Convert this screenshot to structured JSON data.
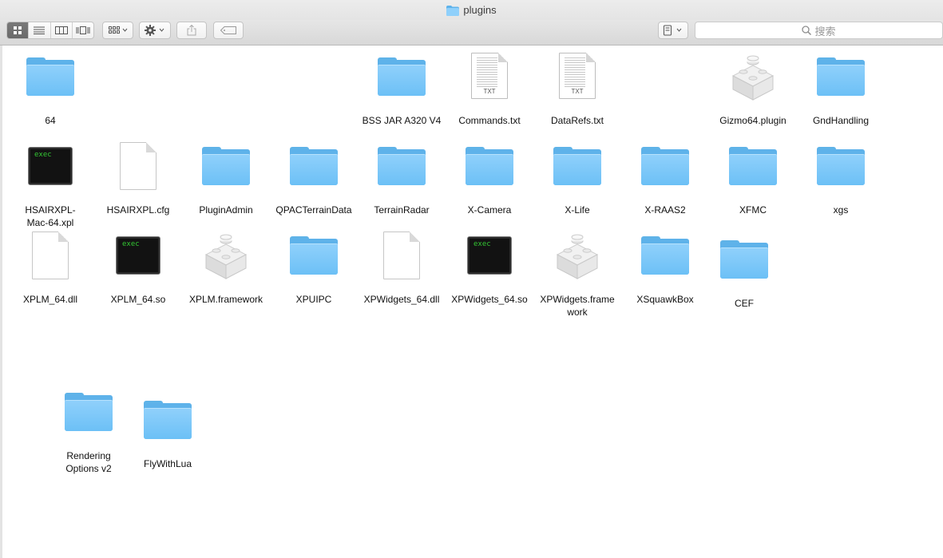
{
  "window": {
    "title": "plugins"
  },
  "toolbar": {
    "view_icons": [
      "icon-view-icon",
      "list-view-icon",
      "column-view-icon",
      "coverflow-view-icon"
    ],
    "arrange_icon": "arrange-icon",
    "action_icon": "gear-icon",
    "share_icon": "share-icon",
    "tag_icon": "tag-icon",
    "path_icon": "path-icon",
    "search_placeholder": "搜索"
  },
  "items": [
    {
      "label": "64",
      "type": "folder"
    },
    {
      "label": "BSS JAR A320 V4",
      "type": "folder"
    },
    {
      "label": "Commands.txt",
      "type": "txt"
    },
    {
      "label": "DataRefs.txt",
      "type": "txt"
    },
    {
      "label": "Gizmo64.plugin",
      "type": "plugin"
    },
    {
      "label": "GndHandling",
      "type": "folder"
    },
    {
      "label": "HSAIRXPL-\nMac-64.xpl",
      "type": "exec"
    },
    {
      "label": "HSAIRXPL.cfg",
      "type": "blank"
    },
    {
      "label": "PluginAdmin",
      "type": "folder"
    },
    {
      "label": "QPACTerrainData",
      "type": "folder"
    },
    {
      "label": "TerrainRadar",
      "type": "folder"
    },
    {
      "label": "X-Camera",
      "type": "folder"
    },
    {
      "label": "X-Life",
      "type": "folder"
    },
    {
      "label": "X-RAAS2",
      "type": "folder"
    },
    {
      "label": "XFMC",
      "type": "folder"
    },
    {
      "label": "xgs",
      "type": "folder"
    },
    {
      "label": "XPLM_64.dll",
      "type": "blank"
    },
    {
      "label": "XPLM_64.so",
      "type": "exec"
    },
    {
      "label": "XPLM.framework",
      "type": "plugin"
    },
    {
      "label": "XPUIPC",
      "type": "folder"
    },
    {
      "label": "XPWidgets_64.dll",
      "type": "blank"
    },
    {
      "label": "XPWidgets_64.so",
      "type": "exec"
    },
    {
      "label": "XPWidgets.frame\nwork",
      "type": "plugin"
    },
    {
      "label": "XSquawkBox",
      "type": "folder"
    },
    {
      "label": "CEF",
      "type": "folder"
    },
    {
      "label": "Rendering\nOptions v2",
      "type": "folder"
    },
    {
      "label": "FlyWithLua",
      "type": "folder"
    }
  ],
  "icon_text": {
    "txt": "TXT",
    "exec": "exec"
  },
  "colors": {
    "folder": "#6cc0f6",
    "exec_text": "#33c733",
    "toolbar": "#dcdcdc"
  }
}
